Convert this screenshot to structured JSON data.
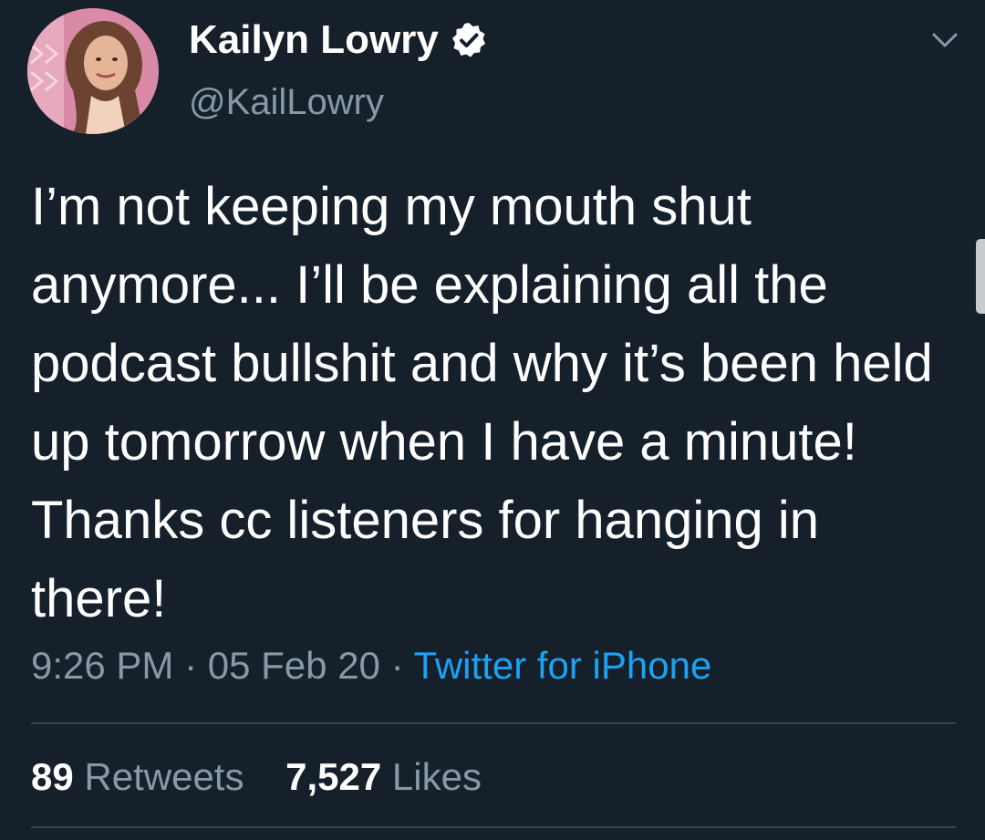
{
  "tweet": {
    "author": {
      "display_name": "Kailyn Lowry",
      "handle": "@KailLowry",
      "verified": true
    },
    "text": "I’m not keeping my mouth shut anymore... I’ll be explaining all the podcast bullshit and why it’s been held up tomorrow when I have a minute! Thanks cc listeners for hanging in there!",
    "time": "9:26 PM",
    "separator": "·",
    "date": "05 Feb 20",
    "source": "Twitter for iPhone",
    "retweets": {
      "count": "89",
      "label": "Retweets"
    },
    "likes": {
      "count": "7,527",
      "label": "Likes"
    }
  },
  "icons": {
    "verified": "verified-badge-icon",
    "menu": "chevron-down-icon"
  },
  "colors": {
    "background": "#15202b",
    "secondary_text": "#8899a6",
    "link": "#1da1f2",
    "divider": "#38444d"
  }
}
